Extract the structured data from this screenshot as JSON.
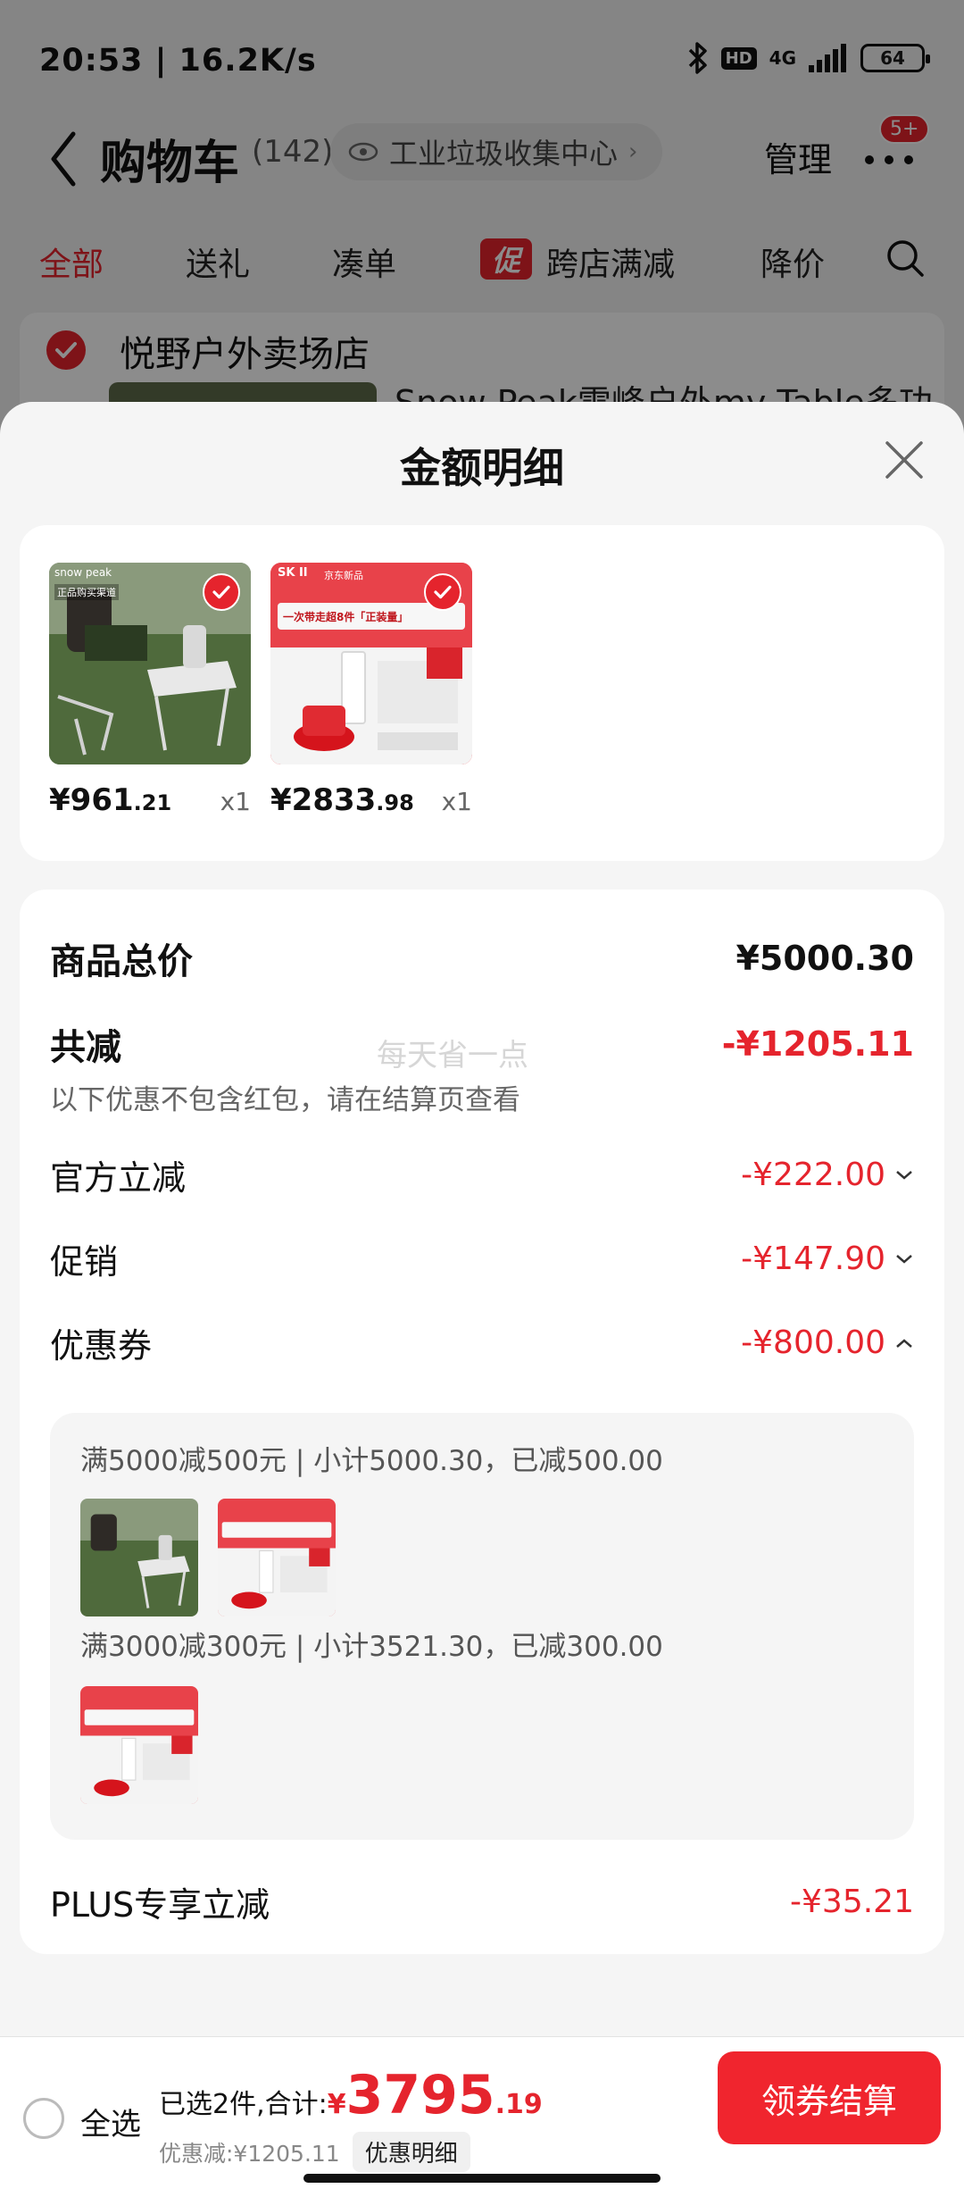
{
  "status_bar": {
    "time_speed": "20:53 | 16.2K/s",
    "hd": "HD",
    "network": "4G",
    "battery": "64"
  },
  "nav": {
    "title": "购物车",
    "count": "(142)",
    "address": "工业垃圾收集中心",
    "manage": "管理",
    "badge": "5+"
  },
  "tabs": {
    "all": "全部",
    "gift": "送礼",
    "combine": "凑单",
    "promo_tag": "促",
    "cross_store": "跨店满减",
    "price_drop": "降价"
  },
  "store": {
    "name": "悦野户外卖场店",
    "product_title": "Snow Peak雪峰户外my Table多功"
  },
  "sheet": {
    "title": "金额明细",
    "products": [
      {
        "price_int": "¥961",
        "price_dec": ".21",
        "qty": "x1",
        "brand": "snow peak",
        "sub": "正品购买渠道"
      },
      {
        "price_int": "¥2833",
        "price_dec": ".98",
        "qty": "x1",
        "brand": "SK II",
        "sub": "京东新品",
        "headline": "一次带走超8件「正装量」"
      }
    ],
    "summary": {
      "total_label": "商品总价",
      "total_value": "¥5000.30",
      "reduce_label": "共减",
      "reduce_value": "-¥1205.11",
      "watermark": "每天省一点",
      "note": "以下优惠不包含红包，请在结算页查看",
      "official_label": "官方立减",
      "official_value": "-¥222.00",
      "promo_label": "促销",
      "promo_value": "-¥147.90",
      "coupon_label": "优惠券",
      "coupon_value": "-¥800.00",
      "coupon_rule_1": "满5000减500元 | 小计5000.30，已减500.00",
      "coupon_rule_2": "满3000减300元 | 小计3521.30，已减300.00",
      "plus_label": "PLUS专享立减",
      "plus_value": "-¥35.21"
    }
  },
  "checkout": {
    "select_all": "全选",
    "selected_prefix": "已选2件,合计:",
    "yen": "¥",
    "total_int": "3795",
    "total_dec": ".19",
    "discount": "优惠减:¥1205.11",
    "detail_button": "优惠明细",
    "checkout_button": "领券结算"
  }
}
